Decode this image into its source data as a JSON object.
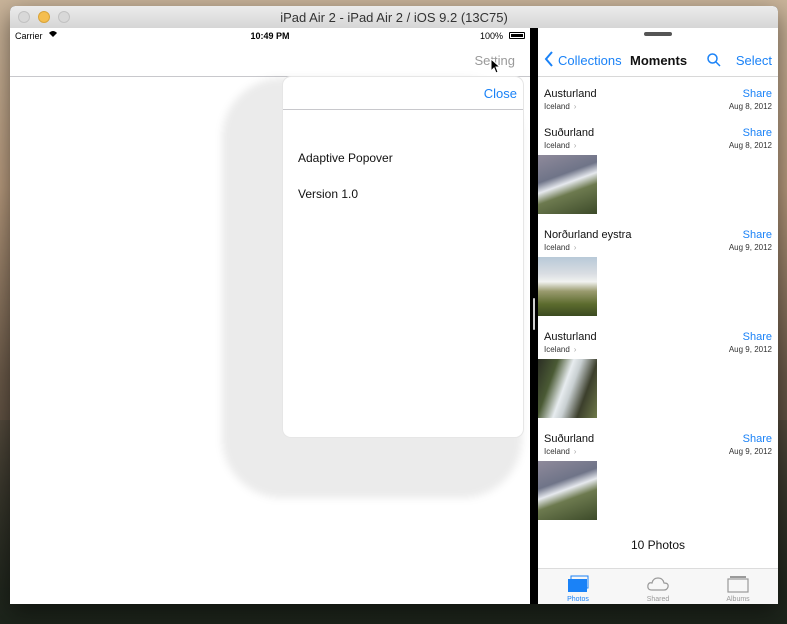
{
  "window": {
    "title": "iPad Air 2 - iPad Air 2 / iOS 9.2 (13C75)"
  },
  "left_app": {
    "status": {
      "carrier": "Carrier",
      "wifi_icon": "wifi-icon",
      "time": "10:49 PM",
      "battery": "100%"
    },
    "nav": {
      "setting_label": "Setting"
    },
    "popover": {
      "close_label": "Close",
      "line1": "Adaptive Popover",
      "line2": "Version 1.0"
    }
  },
  "photos": {
    "nav": {
      "back_label": "Collections",
      "title": "Moments",
      "select_label": "Select"
    },
    "moments": [
      {
        "title": "Austurland",
        "subtitle": "Iceland",
        "share": "Share",
        "date": "Aug 8, 2012"
      },
      {
        "title": "Suðurland",
        "subtitle": "Iceland",
        "share": "Share",
        "date": "Aug 8, 2012"
      },
      {
        "title": "Norðurland eystra",
        "subtitle": "Iceland",
        "share": "Share",
        "date": "Aug 9, 2012"
      },
      {
        "title": "Austurland",
        "subtitle": "Iceland",
        "share": "Share",
        "date": "Aug 9, 2012"
      },
      {
        "title": "Suðurland",
        "subtitle": "Iceland",
        "share": "Share",
        "date": "Aug 9, 2012"
      }
    ],
    "count_label": "10 Photos",
    "tabs": [
      {
        "label": "Photos",
        "color": "#1a82f7"
      },
      {
        "label": "Shared",
        "color": "#9a9a9a"
      },
      {
        "label": "Albums",
        "color": "#9a9a9a"
      }
    ]
  }
}
